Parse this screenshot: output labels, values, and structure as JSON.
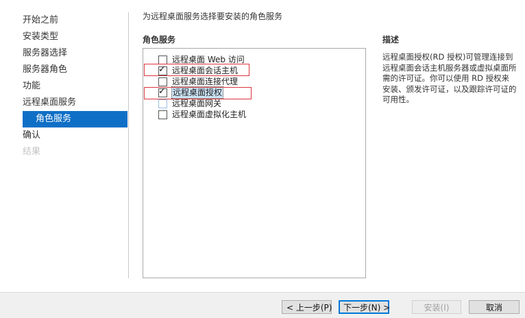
{
  "nav": {
    "items": [
      {
        "label": "开始之前"
      },
      {
        "label": "安装类型"
      },
      {
        "label": "服务器选择"
      },
      {
        "label": "服务器角色"
      },
      {
        "label": "功能"
      },
      {
        "label": "远程桌面服务"
      },
      {
        "label": "角色服务"
      },
      {
        "label": "确认"
      },
      {
        "label": "结果"
      }
    ]
  },
  "main": {
    "subtitle": "为远程桌面服务选择要安装的角色服务",
    "roles_heading": "角色服务",
    "roles": [
      {
        "label": "远程桌面 Web 访问",
        "checked": false
      },
      {
        "label": "远程桌面会话主机",
        "checked": true
      },
      {
        "label": "远程桌面连接代理",
        "checked": false
      },
      {
        "label": "远程桌面授权",
        "checked": true
      },
      {
        "label": "远程桌面网关",
        "checked": false
      },
      {
        "label": "远程桌面虚拟化主机",
        "checked": false
      }
    ],
    "checkmark": "✓"
  },
  "description": {
    "heading": "描述",
    "text": "远程桌面授权(RD 授权)可管理连接到远程桌面会话主机服务器或虚拟桌面所需的许可证。你可以使用 RD 授权来安装、颁发许可证，以及跟踪许可证的可用性。"
  },
  "footer": {
    "prev": "< 上一步(P)",
    "next": "下一步(N) >",
    "install": "安装(I)",
    "cancel": "取消"
  },
  "colors": {
    "accent": "#0f6fc6",
    "highlight_box": "#d9363e"
  }
}
